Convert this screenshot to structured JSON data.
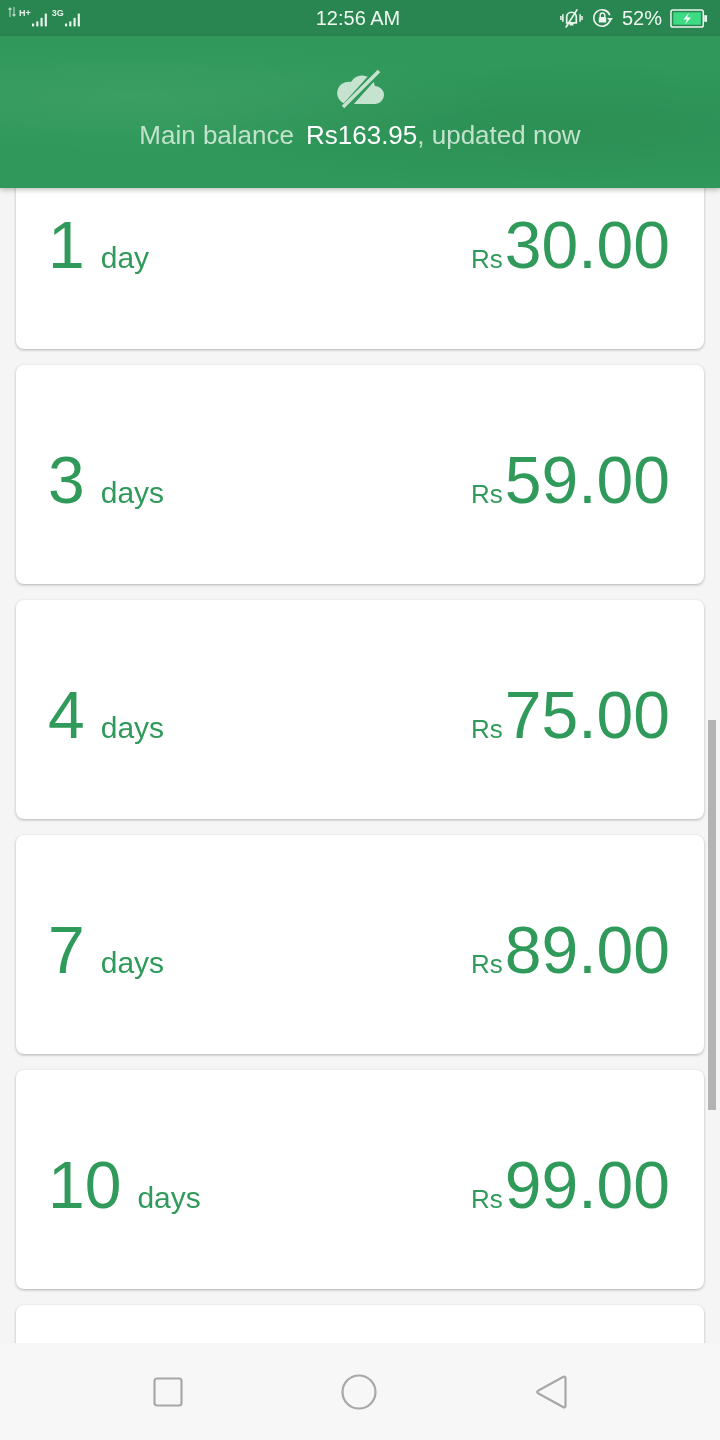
{
  "status_bar": {
    "network_types": [
      "H+",
      "3G"
    ],
    "time": "12:56 AM",
    "battery": "52%"
  },
  "header": {
    "balance_label": "Main balance",
    "balance_amount": "Rs163.95",
    "balance_status": ", updated now"
  },
  "plan_list": {
    "plans": [
      {
        "count": "1",
        "unit": "day",
        "currency": "Rs",
        "price": "30.00"
      },
      {
        "count": "3",
        "unit": "days",
        "currency": "Rs",
        "price": "59.00"
      },
      {
        "count": "4",
        "unit": "days",
        "currency": "Rs",
        "price": "75.00"
      },
      {
        "count": "7",
        "unit": "days",
        "currency": "Rs",
        "price": "89.00"
      },
      {
        "count": "10",
        "unit": "days",
        "currency": "Rs",
        "price": "99.00"
      }
    ],
    "more_below": true
  }
}
